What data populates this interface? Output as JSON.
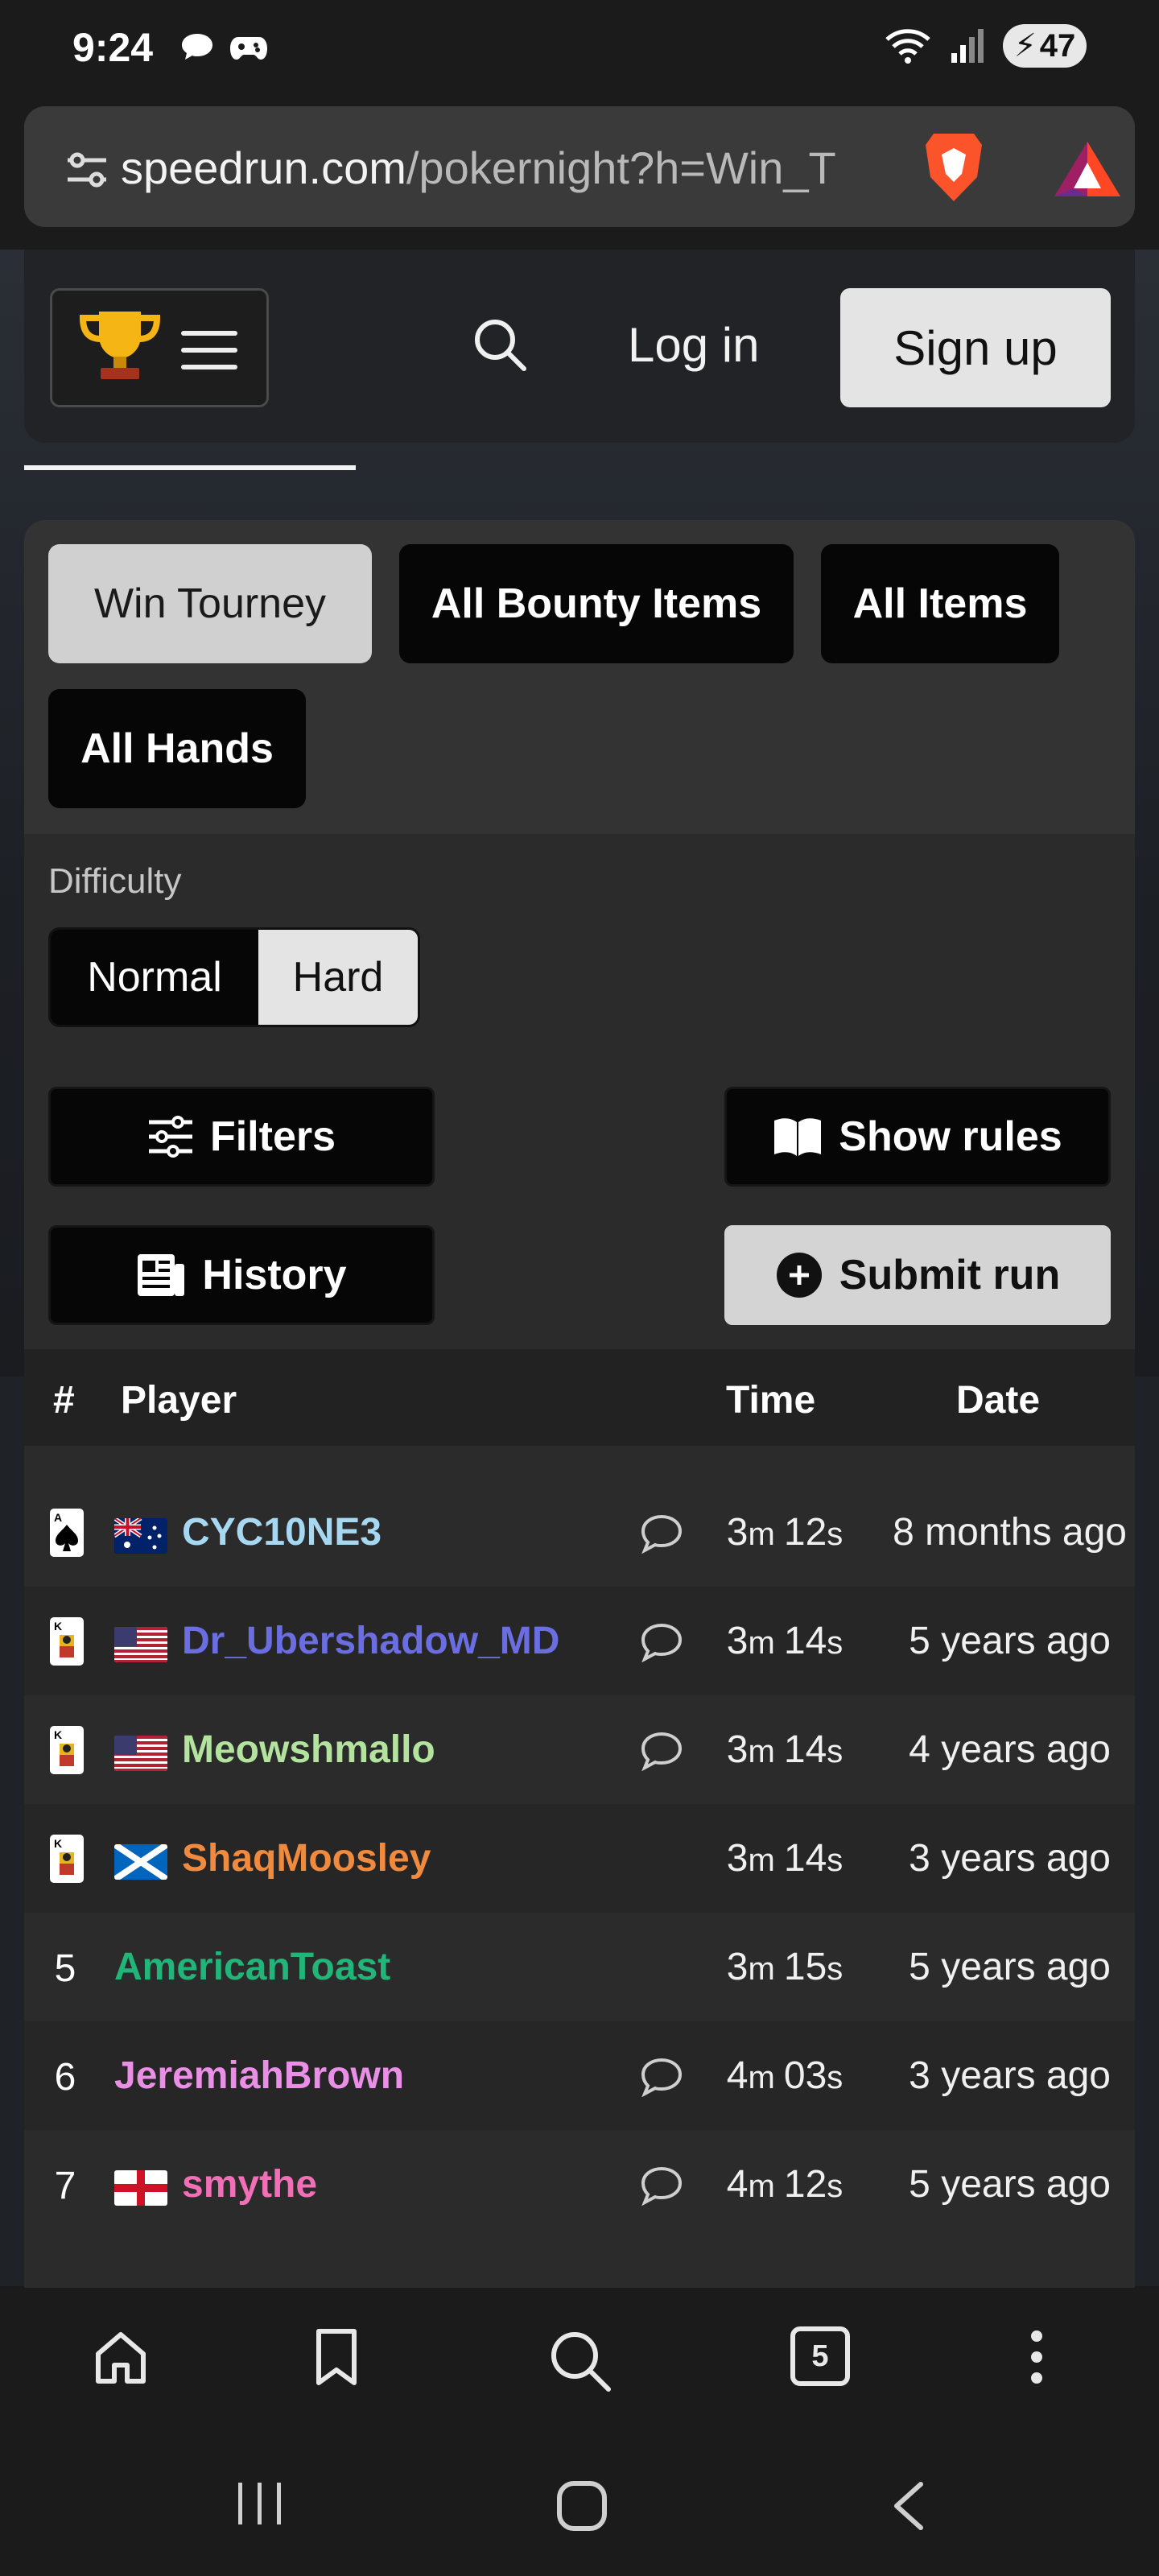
{
  "status_bar": {
    "time": "9:24",
    "battery": "47"
  },
  "browser": {
    "url_host": "speedrun.com",
    "url_path": "/pokernight?h=Win_T"
  },
  "header": {
    "login_label": "Log in",
    "signup_label": "Sign up"
  },
  "categories": [
    {
      "label": "Win Tourney",
      "active": true
    },
    {
      "label": "All Bounty Items",
      "active": false
    },
    {
      "label": "All Items",
      "active": false
    },
    {
      "label": "All Hands",
      "active": false
    }
  ],
  "difficulty": {
    "label": "Difficulty",
    "options": [
      {
        "label": "Normal",
        "active": false
      },
      {
        "label": "Hard",
        "active": true
      }
    ]
  },
  "actions": {
    "filters": "Filters",
    "show_rules": "Show rules",
    "history": "History",
    "submit_run": "Submit run"
  },
  "leaderboard": {
    "columns": {
      "rank": "#",
      "player": "Player",
      "time": "Time",
      "date": "Date"
    },
    "rows": [
      {
        "rank": "1",
        "rank_icon": "ace-card-icon",
        "flag": "australia",
        "player": "CYC10NE3",
        "color": "#a7d8f2",
        "comment": true,
        "time_m": "3",
        "time_s": "12",
        "date": "8 months ago"
      },
      {
        "rank": "2",
        "rank_icon": "king-card-icon",
        "flag": "usa",
        "player": "Dr_Ubershadow_MD",
        "color": "#6b6ee0",
        "comment": true,
        "time_m": "3",
        "time_s": "14",
        "date": "5 years ago"
      },
      {
        "rank": "3",
        "rank_icon": "king-card-icon",
        "flag": "usa",
        "player": "Meowshmallo",
        "color": "#b4e3a0",
        "comment": true,
        "time_m": "3",
        "time_s": "14",
        "date": "4 years ago"
      },
      {
        "rank": "4",
        "rank_icon": "king-card-icon",
        "flag": "scotland",
        "player": "ShaqMoosley",
        "color": "#f08a3e",
        "comment": false,
        "time_m": "3",
        "time_s": "14",
        "date": "3 years ago"
      },
      {
        "rank": "5",
        "rank_icon": "",
        "flag": "",
        "player": "AmericanToast",
        "color": "#22b57a",
        "comment": false,
        "time_m": "3",
        "time_s": "15",
        "date": "5 years ago"
      },
      {
        "rank": "6",
        "rank_icon": "",
        "flag": "",
        "player": "JeremiahBrown",
        "color": "#e98fe6",
        "comment": true,
        "time_m": "4",
        "time_s": "03",
        "date": "3 years ago"
      },
      {
        "rank": "7",
        "rank_icon": "",
        "flag": "england",
        "player": "smythe",
        "color": "#f06fb6",
        "comment": true,
        "time_m": "4",
        "time_s": "12",
        "date": "5 years ago"
      }
    ]
  },
  "bottom_nav": {
    "tab_count": "5"
  }
}
